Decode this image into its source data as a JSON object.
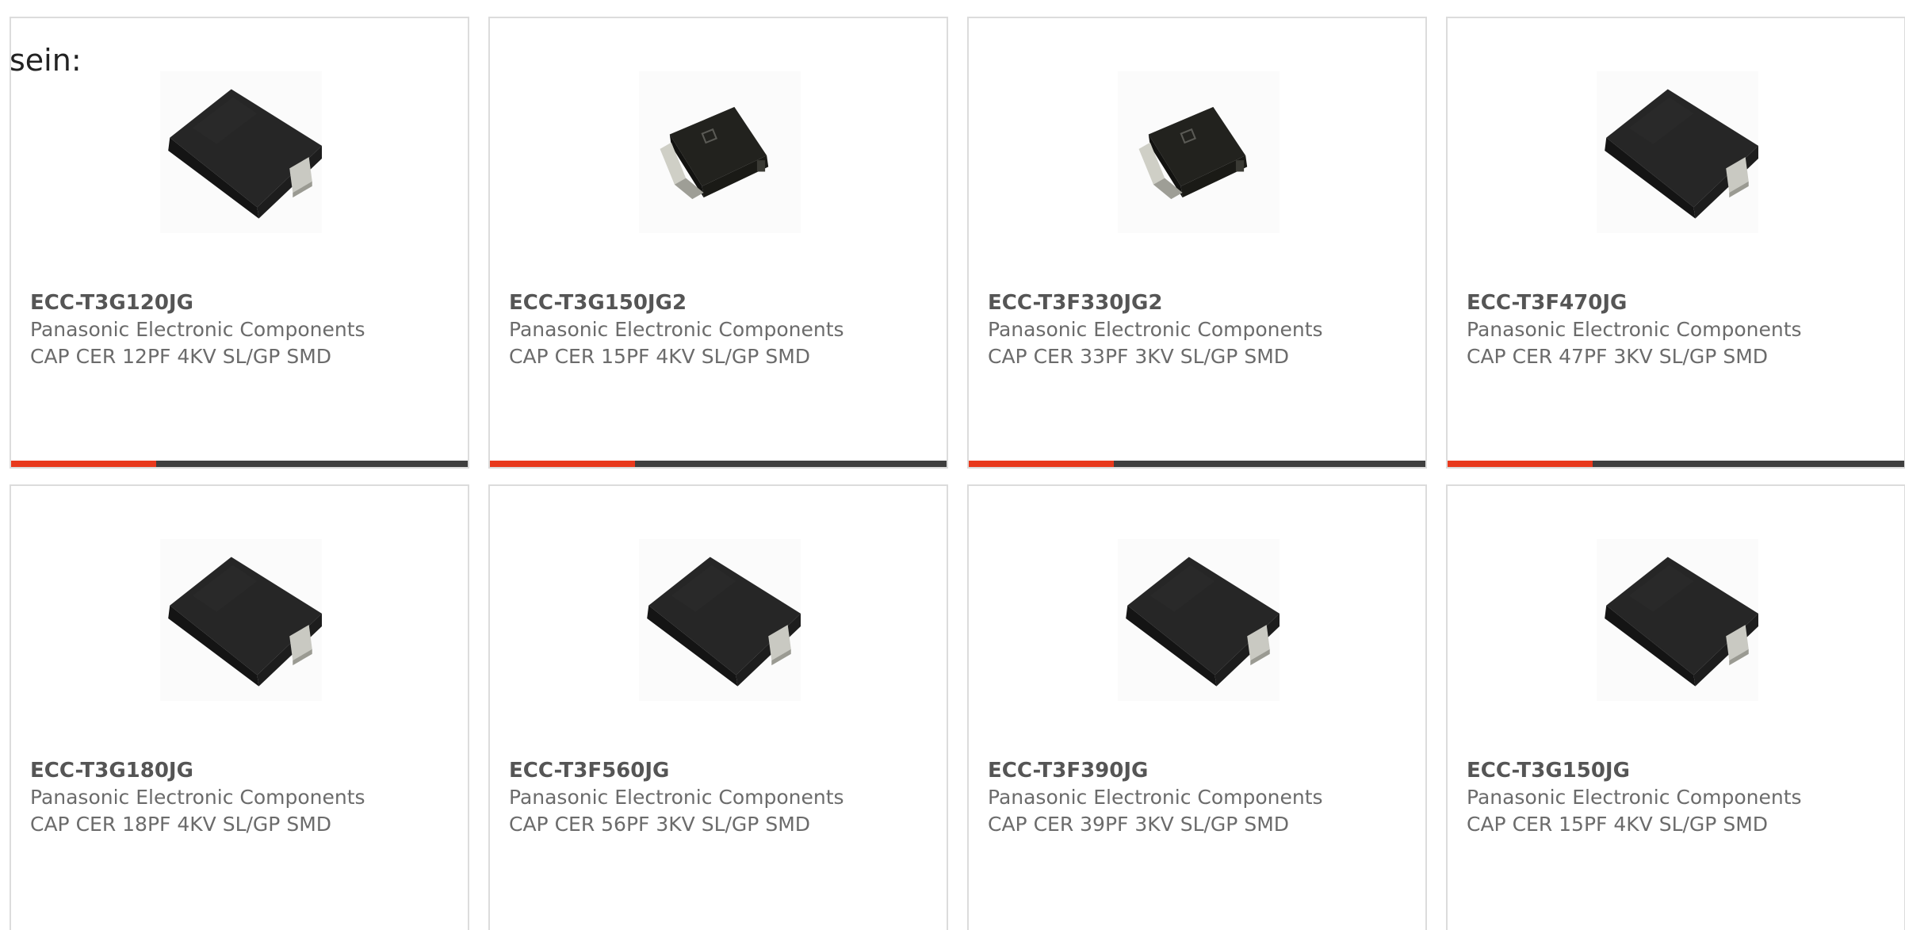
{
  "intro": {
    "text": "sein:"
  },
  "colors": {
    "accent_bar": "#e8391d",
    "dark_bar": "#3f3f3f",
    "card_border": "#dcdcdc",
    "part_number": "#555555",
    "secondary_text": "#6b6b6b"
  },
  "products": [
    {
      "part_number": "ECC-T3G120JG",
      "manufacturer": "Panasonic Electronic Components",
      "description": "CAP CER 12PF 4KV SL/GP SMD",
      "image": "capacitor-large-icon"
    },
    {
      "part_number": "ECC-T3G150JG2",
      "manufacturer": "Panasonic Electronic Components",
      "description": "CAP CER 15PF 4KV SL/GP SMD",
      "image": "capacitor-small-icon"
    },
    {
      "part_number": "ECC-T3F330JG2",
      "manufacturer": "Panasonic Electronic Components",
      "description": "CAP CER 33PF 3KV SL/GP SMD",
      "image": "capacitor-small-icon"
    },
    {
      "part_number": "ECC-T3F470JG",
      "manufacturer": "Panasonic Electronic Components",
      "description": "CAP CER 47PF 3KV SL/GP SMD",
      "image": "capacitor-large-icon"
    },
    {
      "part_number": "ECC-T3G180JG",
      "manufacturer": "Panasonic Electronic Components",
      "description": "CAP CER 18PF 4KV SL/GP SMD",
      "image": "capacitor-large-icon"
    },
    {
      "part_number": "ECC-T3F560JG",
      "manufacturer": "Panasonic Electronic Components",
      "description": "CAP CER 56PF 3KV SL/GP SMD",
      "image": "capacitor-large-icon"
    },
    {
      "part_number": "ECC-T3F390JG",
      "manufacturer": "Panasonic Electronic Components",
      "description": "CAP CER 39PF 3KV SL/GP SMD",
      "image": "capacitor-large-icon"
    },
    {
      "part_number": "ECC-T3G150JG",
      "manufacturer": "Panasonic Electronic Components",
      "description": "CAP CER 15PF 4KV SL/GP SMD",
      "image": "capacitor-large-icon"
    }
  ]
}
